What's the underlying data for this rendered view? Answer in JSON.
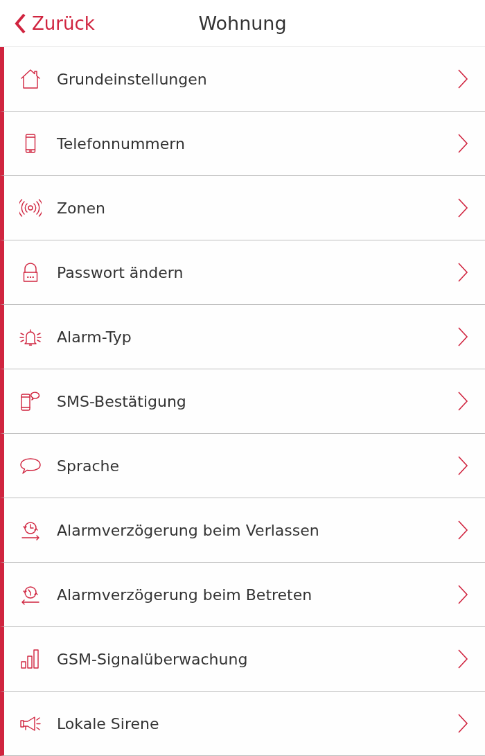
{
  "nav_bar": {
    "back_label": "Zurück",
    "title": "Wohnung"
  },
  "menu_items": [
    {
      "label": "Grundeinstellungen"
    },
    {
      "label": "Telefonnummern"
    },
    {
      "label": "Zonen"
    },
    {
      "label": "Passwort ändern"
    },
    {
      "label": "Alarm-Typ"
    },
    {
      "label": "SMS-Bestätigung"
    },
    {
      "label": "Sprache"
    },
    {
      "label": "Alarmverzögerung beim Verlassen"
    },
    {
      "label": "Alarmverzögerung beim Betreten"
    },
    {
      "label": "GSM-Signalüberwachung"
    },
    {
      "label": "Lokale Sirene"
    }
  ]
}
